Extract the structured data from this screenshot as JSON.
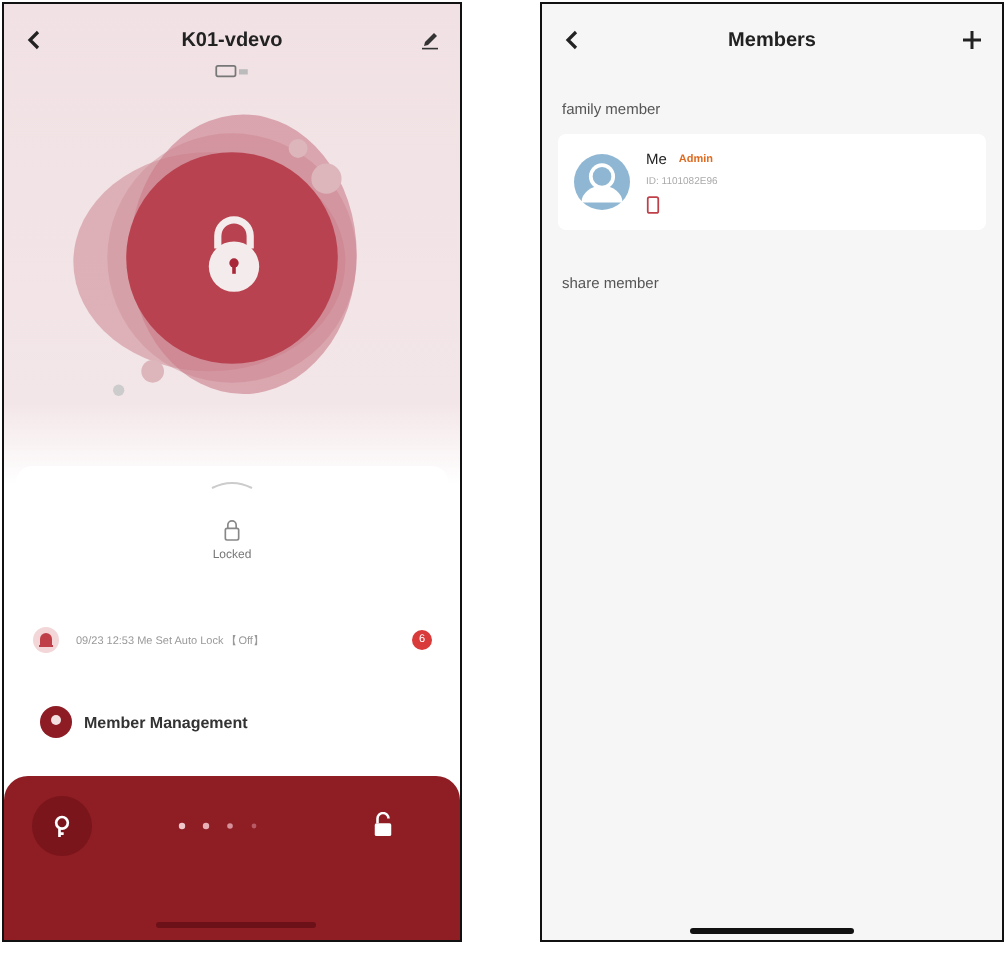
{
  "lock_screen": {
    "title": "K01-vdevo",
    "status": "Locked",
    "record": {
      "text": "09/23 12:53 Me  Set Auto Lock 【Off】",
      "badge": "6"
    },
    "menu_item": "Member Management"
  },
  "members_screen": {
    "title": "Members",
    "sections": [
      {
        "title": "family member",
        "members": [
          {
            "name": "Me",
            "role": "Admin",
            "id": "ID: 1101082E96"
          }
        ]
      },
      {
        "title": "share member"
      }
    ]
  }
}
